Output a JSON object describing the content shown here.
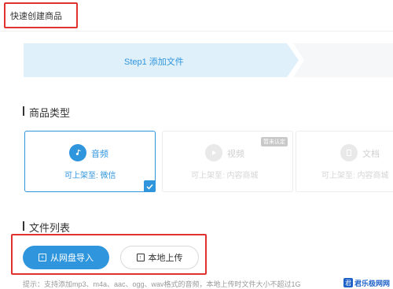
{
  "header": {
    "title": "快速创建商品"
  },
  "steps": {
    "active_label": "Step1 添加文件"
  },
  "product_type": {
    "title": "商品类型",
    "cards": [
      {
        "name": "音频",
        "sub": "可上架至: 微信",
        "icon": "music-note-icon",
        "selected": true
      },
      {
        "name": "视频",
        "sub": "可上架至: 内容商城",
        "icon": "video-icon",
        "badge": "暂未认定",
        "selected": false
      },
      {
        "name": "文档",
        "sub": "可上架至: 内容商城",
        "icon": "document-icon",
        "selected": false
      }
    ]
  },
  "files": {
    "title": "文件列表",
    "import_label": "从网盘导入",
    "upload_label": "本地上传",
    "hint": "提示：支持添加mp3、m4a、aac、ogg、wav格式的音频，本地上传时文件大小不超过1G"
  },
  "watermark": {
    "text": "君乐极网网"
  },
  "colors": {
    "accent": "#2f95dd",
    "highlight": "#e0332f"
  }
}
